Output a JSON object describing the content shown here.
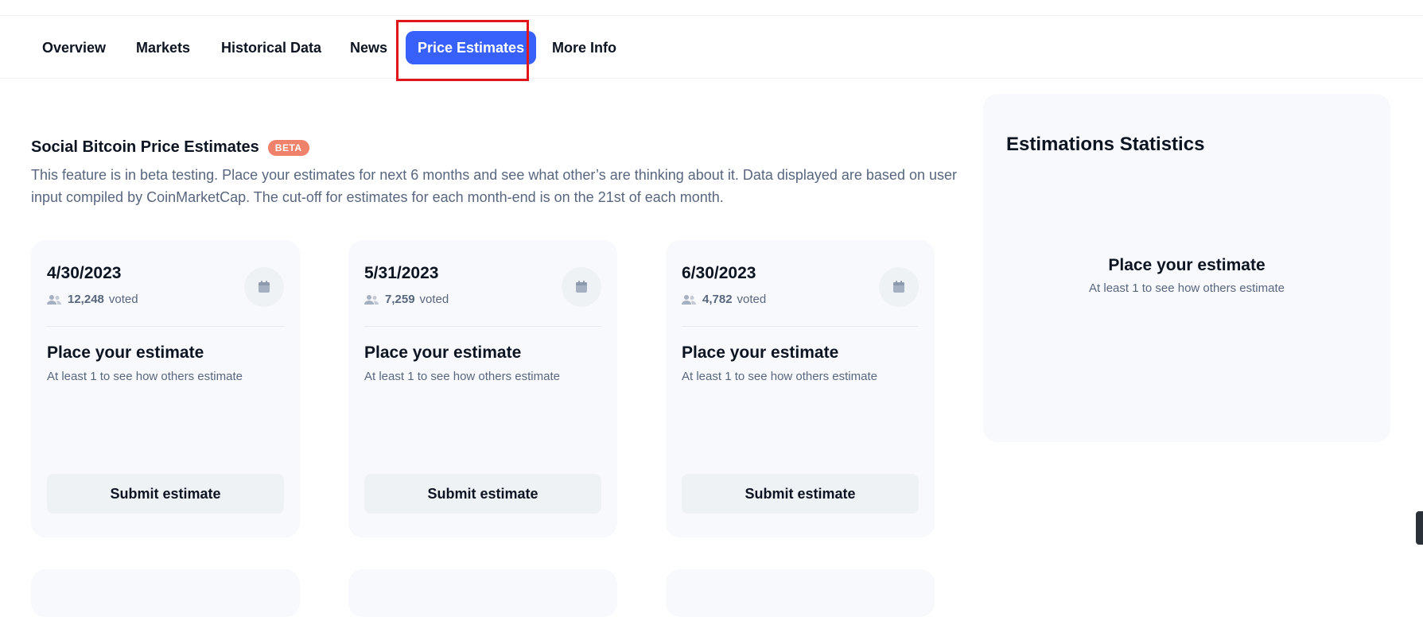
{
  "nav": {
    "tabs": [
      {
        "label": "Overview"
      },
      {
        "label": "Markets"
      },
      {
        "label": "Historical Data"
      },
      {
        "label": "News"
      },
      {
        "label": "Price Estimates",
        "active": true
      },
      {
        "label": "More Info"
      }
    ]
  },
  "section": {
    "title": "Social Bitcoin Price Estimates",
    "badge": "BETA",
    "description": "This feature is in beta testing. Place your estimates for next 6 months and see what other’s are thinking about it. Data displayed are based on user input compiled by CoinMarketCap. The cut-off for estimates for each month-end is on the 21st of each month."
  },
  "cards": [
    {
      "date": "4/30/2023",
      "votes": "12,248",
      "voted_label": "voted",
      "prompt_title": "Place your estimate",
      "prompt_sub": "At least 1 to see how others estimate",
      "button": "Submit estimate"
    },
    {
      "date": "5/31/2023",
      "votes": "7,259",
      "voted_label": "voted",
      "prompt_title": "Place your estimate",
      "prompt_sub": "At least 1 to see how others estimate",
      "button": "Submit estimate"
    },
    {
      "date": "6/30/2023",
      "votes": "4,782",
      "voted_label": "voted",
      "prompt_title": "Place your estimate",
      "prompt_sub": "At least 1 to see how others estimate",
      "button": "Submit estimate"
    }
  ],
  "stats": {
    "title": "Estimations Statistics",
    "prompt_title": "Place your estimate",
    "prompt_sub": "At least 1 to see how others estimate"
  },
  "colors": {
    "accent": "#3861fb",
    "badge": "#f0816a",
    "highlight": "#e0161b",
    "card_bg": "#f8f9fc"
  },
  "icons": {
    "votes": "people-icon",
    "calendar": "calendar-icon"
  }
}
